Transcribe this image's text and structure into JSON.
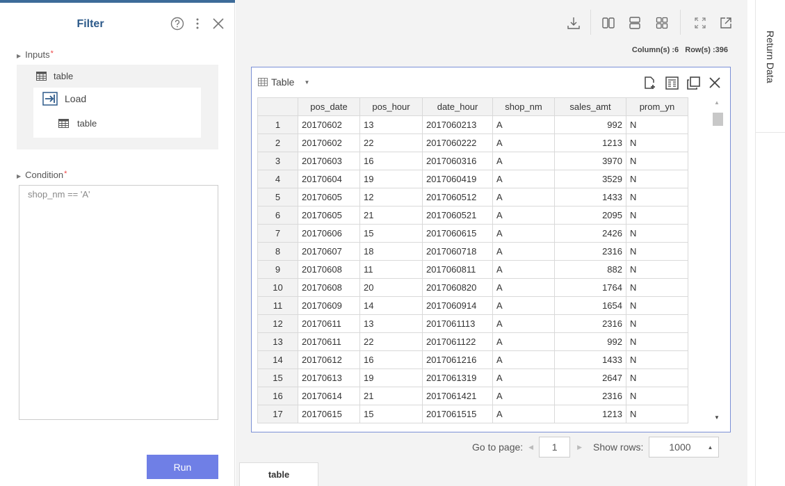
{
  "filter": {
    "title": "Filter",
    "inputs_label": "Inputs",
    "required_mark": "*",
    "input_table": "table",
    "load_label": "Load",
    "load_table": "table",
    "condition_label": "Condition",
    "condition_value": "shop_nm == 'A'",
    "run_label": "Run"
  },
  "toolbar": {
    "status": "Column(s) :6   Row(s) :396"
  },
  "table_panel": {
    "title": "Table",
    "columns": [
      "pos_date",
      "pos_hour",
      "date_hour",
      "shop_nm",
      "sales_amt",
      "prom_yn"
    ],
    "rows": [
      [
        "1",
        "20170602",
        "13",
        "2017060213",
        "A",
        "992",
        "N"
      ],
      [
        "2",
        "20170602",
        "22",
        "2017060222",
        "A",
        "1213",
        "N"
      ],
      [
        "3",
        "20170603",
        "16",
        "2017060316",
        "A",
        "3970",
        "N"
      ],
      [
        "4",
        "20170604",
        "19",
        "2017060419",
        "A",
        "3529",
        "N"
      ],
      [
        "5",
        "20170605",
        "12",
        "2017060512",
        "A",
        "1433",
        "N"
      ],
      [
        "6",
        "20170605",
        "21",
        "2017060521",
        "A",
        "2095",
        "N"
      ],
      [
        "7",
        "20170606",
        "15",
        "2017060615",
        "A",
        "2426",
        "N"
      ],
      [
        "8",
        "20170607",
        "18",
        "2017060718",
        "A",
        "2316",
        "N"
      ],
      [
        "9",
        "20170608",
        "11",
        "2017060811",
        "A",
        "882",
        "N"
      ],
      [
        "10",
        "20170608",
        "20",
        "2017060820",
        "A",
        "1764",
        "N"
      ],
      [
        "11",
        "20170609",
        "14",
        "2017060914",
        "A",
        "1654",
        "N"
      ],
      [
        "12",
        "20170611",
        "13",
        "2017061113",
        "A",
        "2316",
        "N"
      ],
      [
        "13",
        "20170611",
        "22",
        "2017061122",
        "A",
        "992",
        "N"
      ],
      [
        "14",
        "20170612",
        "16",
        "2017061216",
        "A",
        "1433",
        "N"
      ],
      [
        "15",
        "20170613",
        "19",
        "2017061319",
        "A",
        "2647",
        "N"
      ],
      [
        "16",
        "20170614",
        "21",
        "2017061421",
        "A",
        "2316",
        "N"
      ],
      [
        "17",
        "20170615",
        "15",
        "2017061515",
        "A",
        "1213",
        "N"
      ]
    ]
  },
  "pager": {
    "goto_label": "Go to page:",
    "page": "1",
    "show_rows_label": "Show rows:",
    "rows_value": "1000"
  },
  "bottom_tab": "table",
  "right_rail": {
    "label": "Return Data"
  }
}
